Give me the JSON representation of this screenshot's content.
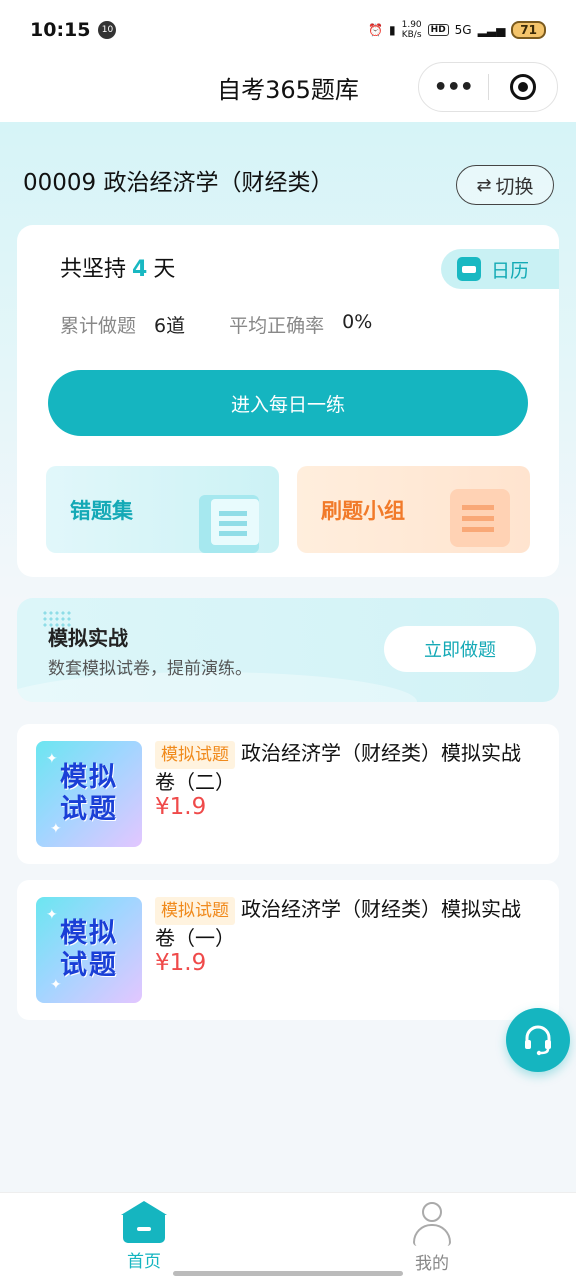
{
  "status_bar": {
    "time": "10:15",
    "notif_badge": "10",
    "net_speed_top": "1.90",
    "net_speed_bottom": "KB/s",
    "hd": "HD",
    "signal": "5G",
    "battery": "71"
  },
  "nav": {
    "title": "自考365题库",
    "more_label": "•••"
  },
  "subject": {
    "title": "00009 政治经济学（财经类）",
    "switch_label": "切换"
  },
  "summary": {
    "streak_prefix": "共坚持",
    "streak_days": "4",
    "streak_suffix": "天",
    "calendar_label": "日历",
    "total_label": "累计做题",
    "total_value": "6道",
    "accuracy_label": "平均正确率",
    "accuracy_value": "0%",
    "daily_button": "进入每日一练",
    "wrong_set": "错题集",
    "practice_group": "刷题小组"
  },
  "mock": {
    "title": "模拟实战",
    "subtitle": "数套模拟试卷，提前演练。",
    "button": "立即做题"
  },
  "products": [
    {
      "thumb_line1": "模拟",
      "thumb_line2": "试题",
      "tag": "模拟试题",
      "name": "政治经济学（财经类）模拟实战卷（二）",
      "price": "¥1.9"
    },
    {
      "thumb_line1": "模拟",
      "thumb_line2": "试题",
      "tag": "模拟试题",
      "name": "政治经济学（财经类）模拟实战卷（一）",
      "price": "¥1.9"
    }
  ],
  "tabs": [
    {
      "label": "首页",
      "icon": "home-icon",
      "active": true
    },
    {
      "label": "我的",
      "icon": "user-icon",
      "active": false
    }
  ],
  "colors": {
    "accent": "#15b5c0",
    "price": "#ef4a4a",
    "orange": "#f17a2a"
  }
}
